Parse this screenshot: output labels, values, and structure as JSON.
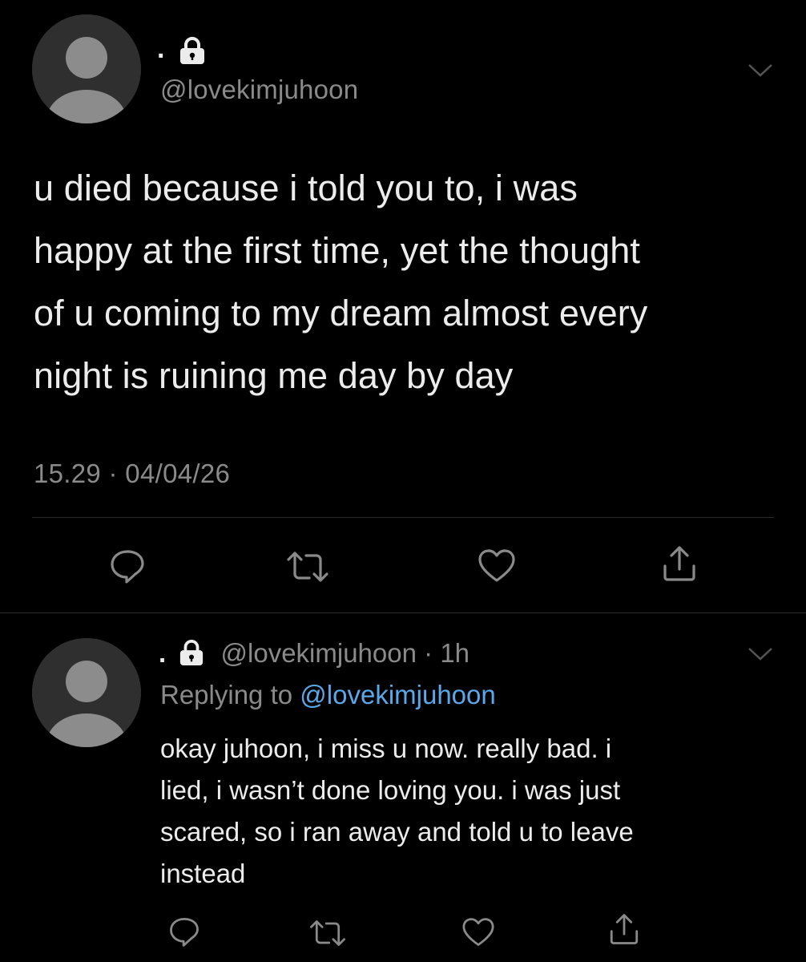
{
  "main_tweet": {
    "display_name": ".",
    "handle": "@lovekimjuhoon",
    "text_lines": [
      "u died because i told you to, i was",
      "happy at the first time, yet the thought",
      "of u coming to my dream almost every",
      "night is ruining me day by day"
    ],
    "timestamp": "15.29 · 04/04/26",
    "icons": {
      "lock": "lock-icon",
      "more": "chevron-down-icon",
      "reply": "reply-icon",
      "retweet": "retweet-icon",
      "like": "heart-icon",
      "share": "share-icon"
    }
  },
  "reply_tweet": {
    "display_name": ".",
    "handle": "@lovekimjuhoon",
    "separator": "·",
    "time_ago": "1h",
    "replying_prefix": "Replying to",
    "replying_mention": "@lovekimjuhoon",
    "text_lines": [
      "okay juhoon, i miss u now. really bad. i",
      "lied, i wasn’t done loving you. i was just",
      "scared, so i ran away and told u to leave",
      "instead"
    ]
  },
  "colors": {
    "background": "#000000",
    "text": "#ececec",
    "muted": "#8a8a8a",
    "link": "#5aa7ea",
    "divider": "#2c2c2c"
  }
}
